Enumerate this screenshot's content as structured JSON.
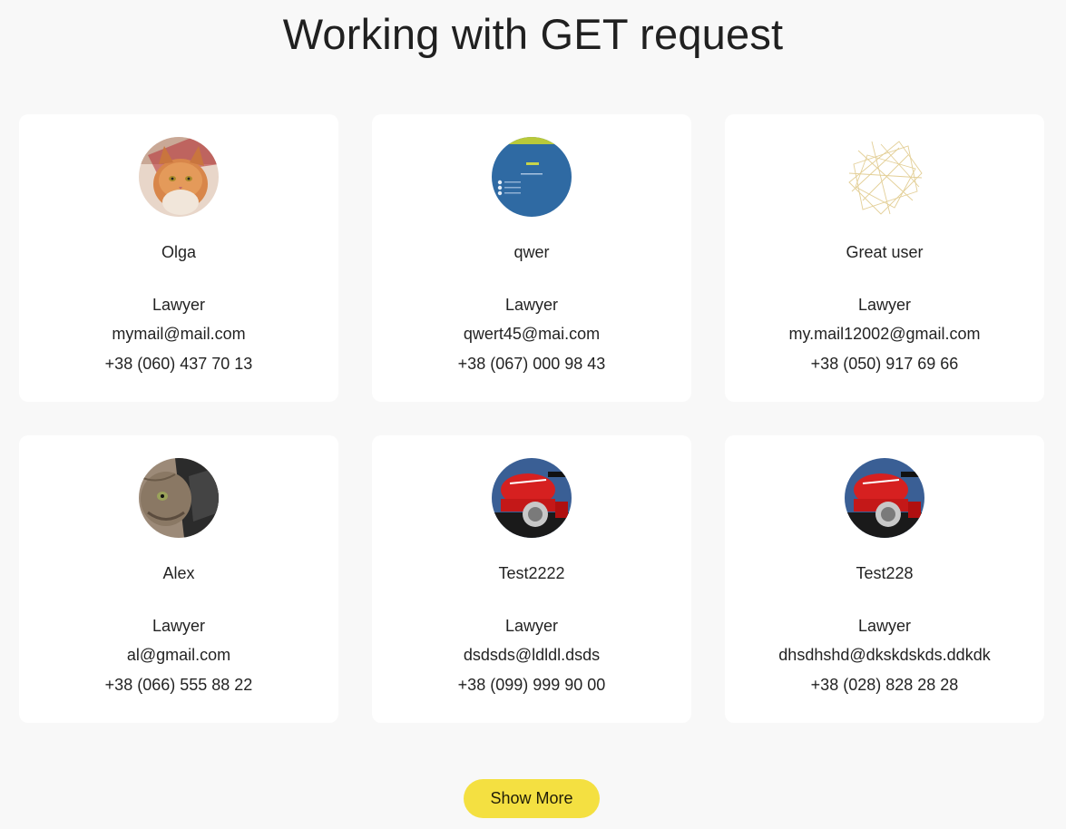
{
  "page": {
    "title": "Working with GET request"
  },
  "users": [
    {
      "name": "Olga",
      "position": "Lawyer",
      "email": "mymail@mail.com",
      "phone": "+38 (060) 437 70 13",
      "avatar": "cat-photo"
    },
    {
      "name": "qwer",
      "position": "Lawyer",
      "email": "qwert45@mai.com",
      "phone": "+38 (067) 000 98 43",
      "avatar": "screenshot-blue"
    },
    {
      "name": "Great user",
      "position": "Lawyer",
      "email": "my.mail12002@gmail.com",
      "phone": "+38 (050) 917 69 66",
      "avatar": "gold-lines"
    },
    {
      "name": "Alex",
      "position": "Lawyer",
      "email": "al@gmail.com",
      "phone": "+38 (066) 555 88 22",
      "avatar": "cat-photo-2"
    },
    {
      "name": "Test2222",
      "position": "Lawyer",
      "email": "dsdsds@ldldl.dsds",
      "phone": "+38 (099) 999 90 00",
      "avatar": "motorcycle"
    },
    {
      "name": "Test228",
      "position": "Lawyer",
      "email": "dhsdhshd@dkskdskds.ddkdk",
      "phone": "+38 (028) 828 28 28",
      "avatar": "motorcycle"
    }
  ],
  "actions": {
    "show_more_label": "Show More"
  },
  "colors": {
    "background": "#f8f8f8",
    "card": "#ffffff",
    "button": "#f4e041"
  }
}
